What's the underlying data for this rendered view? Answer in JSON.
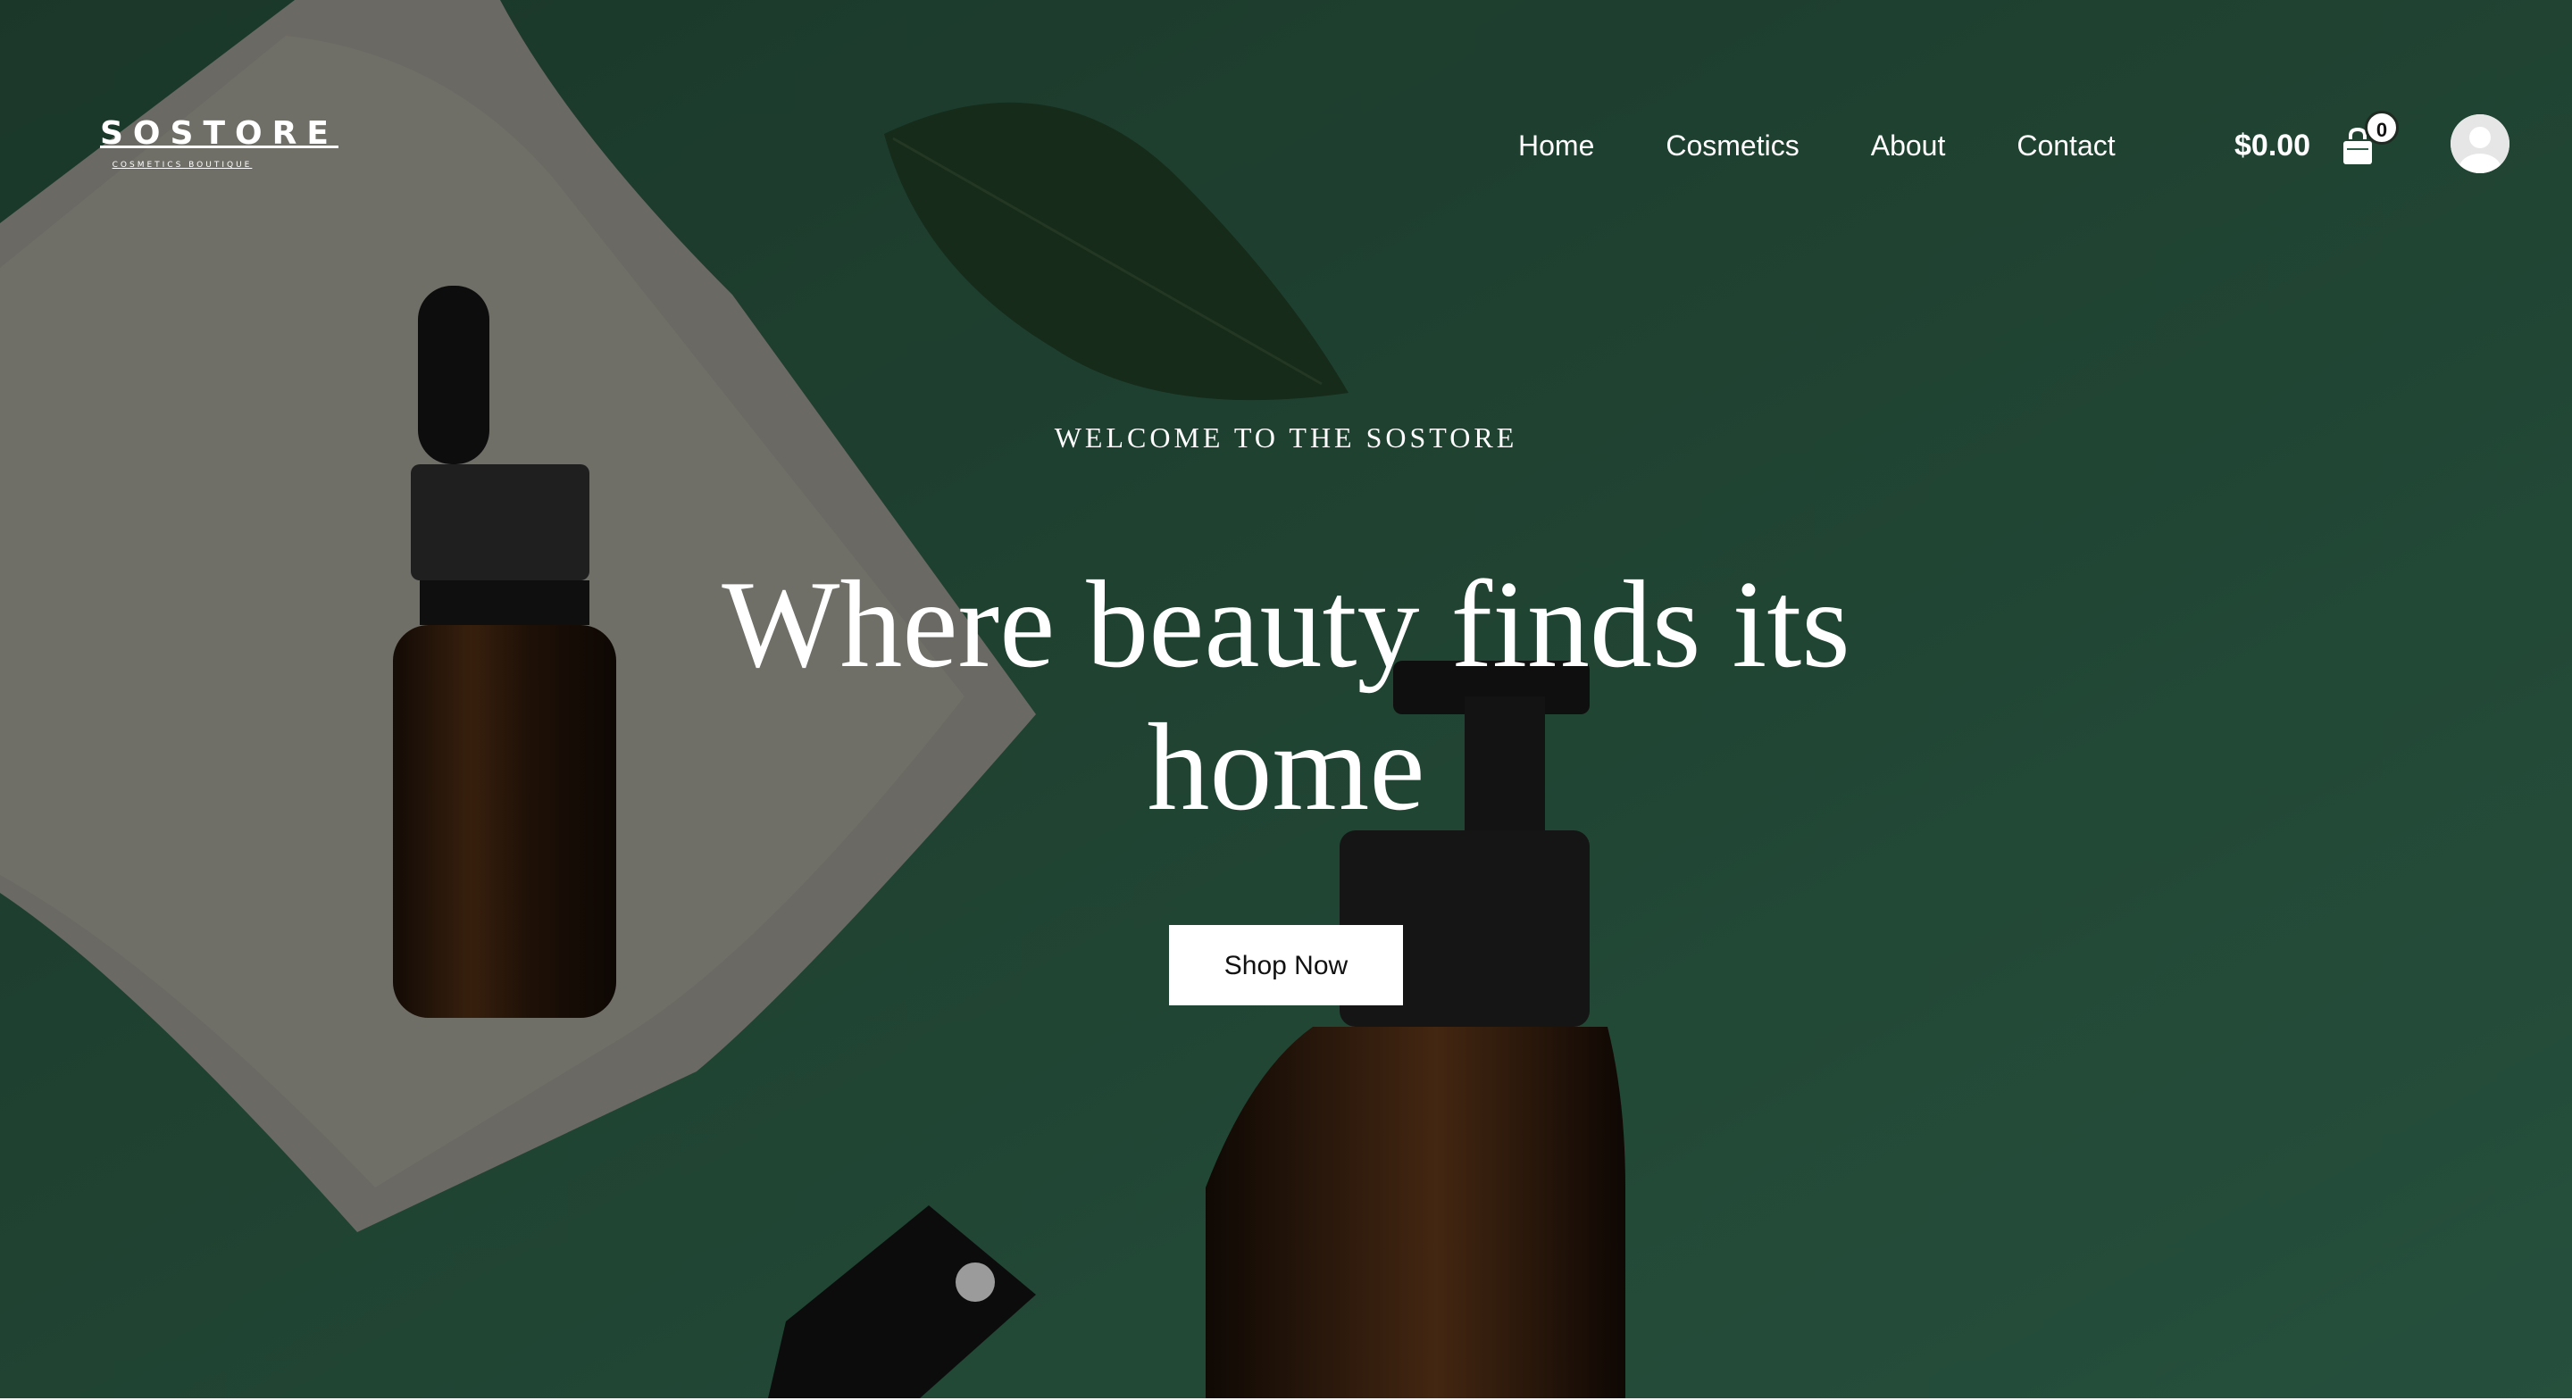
{
  "brand": {
    "name": "SOSTORE",
    "tagline": "COSMETICS BOUTIQUE"
  },
  "nav": {
    "items": [
      {
        "label": "Home"
      },
      {
        "label": "Cosmetics"
      },
      {
        "label": "About"
      },
      {
        "label": "Contact"
      }
    ]
  },
  "cart": {
    "total": "$0.00",
    "count": "0",
    "icon": "shopping-bag-icon"
  },
  "user": {
    "icon": "user-avatar-icon"
  },
  "hero": {
    "eyebrow": "WELCOME TO THE SOSTORE",
    "headline": "Where beauty finds its home",
    "cta_label": "Shop Now"
  },
  "colors": {
    "background_green": "#2e5c46",
    "text": "#ffffff",
    "button_bg": "#ffffff",
    "button_text": "#111111"
  }
}
